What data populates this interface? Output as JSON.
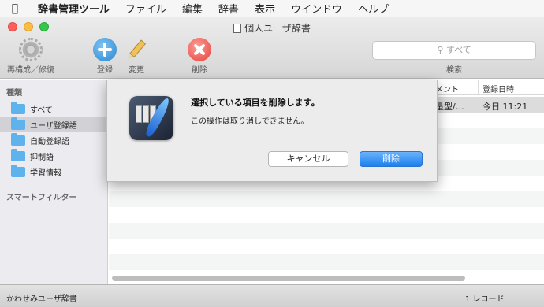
{
  "menubar": {
    "app": "辞書管理ツール",
    "items": [
      "ファイル",
      "編集",
      "辞書",
      "表示",
      "ウインドウ",
      "ヘルプ"
    ]
  },
  "window": {
    "title": "個人ユーザ辞書"
  },
  "toolbar": {
    "rebuild_label": "再構成／修復",
    "add_label": "登録",
    "edit_label": "変更",
    "delete_label": "削除",
    "search_placeholder": "すべて",
    "search_label": "検索"
  },
  "sidebar": {
    "heading": "種類",
    "items": [
      {
        "label": "すべて"
      },
      {
        "label": "ユーザ登録語"
      },
      {
        "label": "自動登録語"
      },
      {
        "label": "抑制語"
      },
      {
        "label": "学習情報"
      }
    ],
    "smart_heading": "スマートフィルター"
  },
  "table": {
    "columns": [
      "メント",
      "登録日時"
    ],
    "selected_row": {
      "comment": "量型/…",
      "date": "今日 11:21"
    }
  },
  "statusbar": {
    "dictionary": "かわせみユーザ辞書",
    "records": "1 レコード"
  },
  "dialog": {
    "title": "選択している項目を削除します。",
    "message": "この操作は取り消しできません。",
    "cancel_label": "キャンセル",
    "delete_label": "削除"
  },
  "colors": {
    "accent": "#1b7ff0",
    "folder": "#5eb3ec",
    "delete_red": "#e0443d"
  }
}
